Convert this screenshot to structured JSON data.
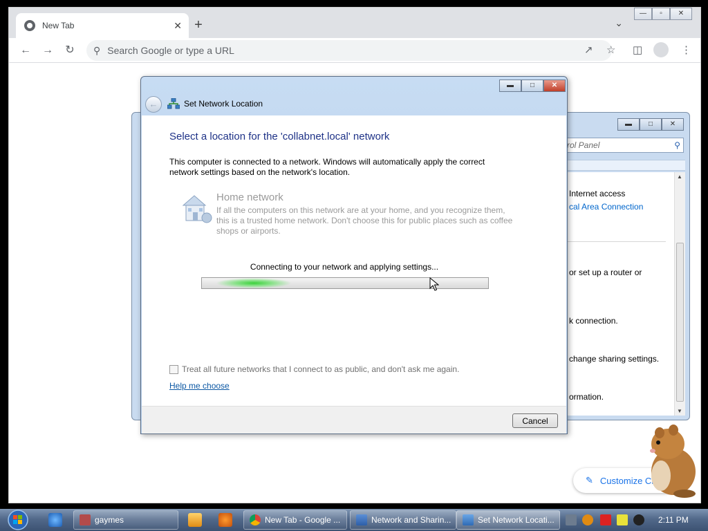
{
  "browser": {
    "tab_title": "New Tab",
    "tab_close": "✕",
    "new_tab": "+",
    "tab_dropdown": "⌄",
    "omnibox_placeholder": "Search Google or type a URL",
    "customize_label": "Customize Ch",
    "window_controls": {
      "minimize": "—",
      "restore": "▫",
      "close": "✕"
    }
  },
  "control_panel": {
    "search_placeholder": "rol Panel",
    "lines": [
      {
        "text": "Internet access",
        "link": false
      },
      {
        "text": "cal Area Connection",
        "link": true
      },
      {
        "text": "or set up a router or",
        "link": false
      },
      {
        "text": "k connection.",
        "link": false
      },
      {
        "text": "change sharing settings.",
        "link": false
      },
      {
        "text": "ormation.",
        "link": false
      }
    ]
  },
  "dialog": {
    "title": "Set Network Location",
    "heading": "Select a location for the 'collabnet.local' network",
    "intro": "This computer is connected to a network. Windows will automatically apply the correct network settings based on the network's location.",
    "option": {
      "title": "Home network",
      "description": "If all the computers on this network are at your home, and you recognize them, this is a trusted home network.  Don't choose this for public places such as coffee shops or airports."
    },
    "progress_label": "Connecting to your network and applying settings...",
    "progress_indeterminate": true,
    "checkbox_label": "Treat all future networks that I connect to as public, and don't ask me again.",
    "checkbox_checked": false,
    "help_link": "Help me choose",
    "cancel_label": "Cancel"
  },
  "taskbar": {
    "buttons": [
      {
        "label": "gaymes",
        "icon": "folder-icon",
        "active": false
      },
      {
        "label": "New Tab - Google ...",
        "icon": "chrome-icon",
        "active": false
      },
      {
        "label": "Network and Sharin...",
        "icon": "network-icon",
        "active": false
      },
      {
        "label": "Set Network Locati...",
        "icon": "network-location-icon",
        "active": true
      }
    ],
    "clock": "2:11 PM"
  },
  "colors": {
    "dialog_heading": "#1e3287",
    "link": "#0b57a3",
    "progress_glow": "#3bd13b",
    "taskbar": "#52698a"
  }
}
